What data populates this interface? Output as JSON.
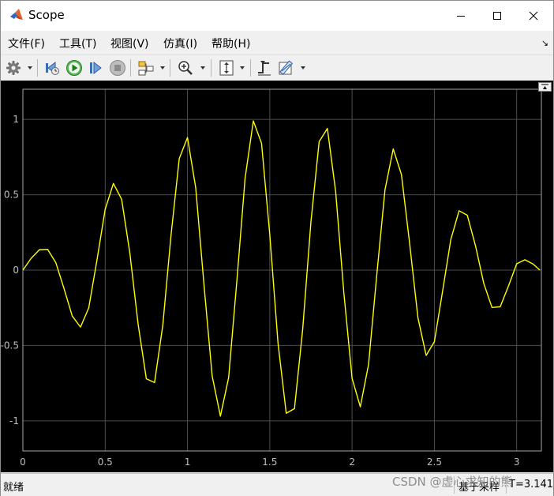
{
  "window": {
    "title": "Scope",
    "minimize_icon": "minimize-icon",
    "maximize_icon": "maximize-icon",
    "close_icon": "close-icon"
  },
  "menu": {
    "items": [
      {
        "label": "文件(F)"
      },
      {
        "label": "工具(T)"
      },
      {
        "label": "视图(V)"
      },
      {
        "label": "仿真(I)"
      },
      {
        "label": "帮助(H)"
      }
    ],
    "expand_glyph": "↘"
  },
  "toolbar": {
    "buttons": [
      {
        "icon": "settings-gear-icon"
      },
      {
        "icon": "step-back-icon"
      },
      {
        "icon": "run-icon"
      },
      {
        "icon": "step-forward-icon"
      },
      {
        "icon": "stop-icon"
      },
      {
        "icon": "highlight-block-icon"
      },
      {
        "icon": "zoom-in-icon"
      },
      {
        "icon": "autoscale-icon"
      },
      {
        "icon": "triggers-icon"
      },
      {
        "icon": "measurements-icon"
      }
    ]
  },
  "status": {
    "text": "就绪",
    "mode": "基于采样",
    "offset": "T=3.141"
  },
  "watermark": "CSDN @虚心求知的熊",
  "colors": {
    "plot_background": "#000000",
    "grid": "#4d4d4d",
    "axis_frame": "#a6a6a6",
    "tick_label": "#bfbfbf",
    "trace": "#ffff00"
  },
  "chart_data": {
    "type": "line",
    "title": "",
    "xlabel": "",
    "ylabel": "",
    "xlim": [
      0,
      3.15
    ],
    "ylim": [
      -1.2,
      1.2
    ],
    "x_ticks": [
      0,
      0.5,
      1,
      1.5,
      2,
      2.5,
      3
    ],
    "x_tick_labels": [
      "0",
      "0.5",
      "1",
      "1.5",
      "2",
      "2.5",
      "3"
    ],
    "y_ticks": [
      1,
      0.5,
      0,
      -0.5,
      -1
    ],
    "y_tick_labels": [
      "1",
      "0.5",
      "0",
      "-0.5",
      "-1"
    ],
    "grid": true,
    "legend": "none",
    "series": [
      {
        "color": "#ffff00",
        "x": [
          0,
          0.05,
          0.1,
          0.15,
          0.2,
          0.25,
          0.3,
          0.35,
          0.4,
          0.45,
          0.5,
          0.55,
          0.6,
          0.65,
          0.7,
          0.75,
          0.8,
          0.85,
          0.9,
          0.95,
          1.0,
          1.05,
          1.1,
          1.15,
          1.2,
          1.25,
          1.3,
          1.35,
          1.4,
          1.45,
          1.5,
          1.55,
          1.6,
          1.65,
          1.7,
          1.75,
          1.8,
          1.85,
          1.9,
          1.95,
          2.0,
          2.05,
          2.1,
          2.15,
          2.2,
          2.25,
          2.3,
          2.35,
          2.4,
          2.45,
          2.5,
          2.55,
          2.6,
          2.65,
          2.7,
          2.75,
          2.8,
          2.85,
          2.9,
          2.95,
          3.0,
          3.05,
          3.1,
          3.141
        ],
        "y": [
          0,
          0.078,
          0.135,
          0.138,
          0.05,
          -0.123,
          -0.305,
          -0.378,
          -0.251,
          0.066,
          0.404,
          0.575,
          0.47,
          0.112,
          -0.358,
          -0.721,
          -0.746,
          -0.366,
          0.231,
          0.74,
          0.88,
          0.546,
          -0.094,
          -0.703,
          -0.969,
          -0.713,
          -0.072,
          0.61,
          0.99,
          0.841,
          0.234,
          -0.484,
          -0.95,
          -0.919,
          -0.391,
          0.32,
          0.853,
          0.94,
          0.523,
          -0.15,
          -0.718,
          -0.907,
          -0.626,
          -0.032,
          0.534,
          0.804,
          0.633,
          0.174,
          -0.316,
          -0.566,
          -0.475,
          -0.139,
          0.204,
          0.394,
          0.364,
          0.161,
          -0.088,
          -0.248,
          -0.243,
          -0.106,
          0.042,
          0.069,
          0.04,
          0
        ]
      }
    ]
  }
}
